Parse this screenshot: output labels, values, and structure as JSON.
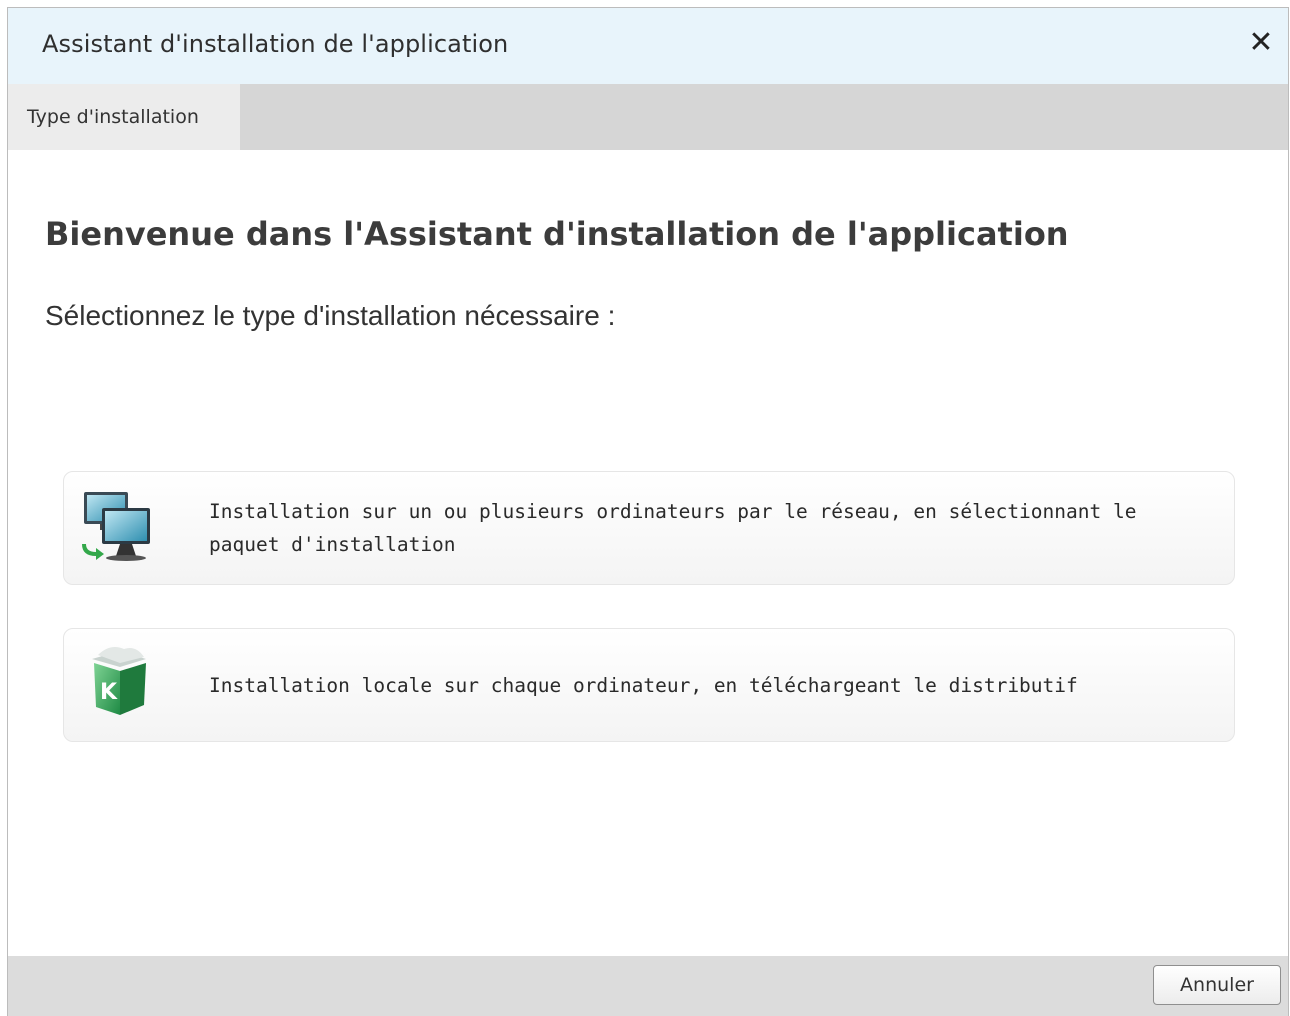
{
  "window": {
    "title": "Assistant d'installation de l'application",
    "close_glyph": "✕",
    "close_icon": "close-icon"
  },
  "tabs": [
    {
      "label": "Type d'installation",
      "active": true
    }
  ],
  "main": {
    "heading": "Bienvenue dans l'Assistant d'installation de l'application",
    "subheading": "Sélectionnez le type d'installation nécessaire :"
  },
  "options": [
    {
      "icon": "network-computers-icon",
      "label": "Installation sur un ou plusieurs ordinateurs par le réseau, en sélectionnant le paquet d'installation"
    },
    {
      "icon": "package-box-icon",
      "label": "Installation locale sur chaque ordinateur, en téléchargeant le distributif"
    }
  ],
  "footer": {
    "cancel_label": "Annuler"
  },
  "colors": {
    "titlebar_bg": "#e8f4fb",
    "tabstrip_bg": "#d6d6d6",
    "active_tab_bg": "#ececec",
    "footer_bg": "#dcdcdc",
    "brand_green": "#2e9e52"
  }
}
